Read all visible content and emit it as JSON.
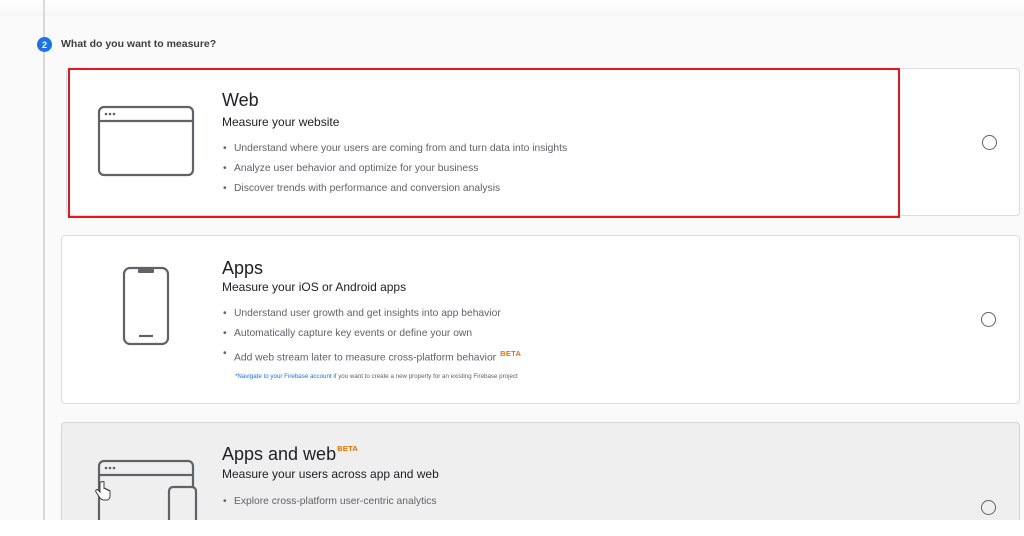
{
  "step": {
    "number": "2",
    "title": "What do you want to measure?"
  },
  "options": {
    "web": {
      "title": "Web",
      "subtitle": "Measure your website",
      "bullets": [
        "Understand where your users are coming from and turn data into insights",
        "Analyze user behavior and optimize for your business",
        "Discover trends with performance and conversion analysis"
      ],
      "icon": "browser-window-icon"
    },
    "apps": {
      "title": "Apps",
      "subtitle": "Measure your iOS or Android apps",
      "bullets": [
        "Understand user growth and get insights into app behavior",
        "Automatically capture key events or define your own",
        "Add web stream later to measure cross-platform behavior"
      ],
      "beta_label": "BETA",
      "firebase_link": "*Navigate to your Firebase account",
      "firebase_rest": " if you want to create a new property for an existing Firebase project",
      "icon": "phone-icon"
    },
    "apps_and_web": {
      "title": "Apps and web",
      "beta_label": "BETA",
      "subtitle": "Measure your users across app and web",
      "bullets": [
        "Explore cross-platform user-centric analytics"
      ],
      "icon": "browser-and-phone-icon"
    }
  },
  "colors": {
    "accent": "#1a73e8",
    "highlight": "#e8141e",
    "beta": "#e37400"
  }
}
